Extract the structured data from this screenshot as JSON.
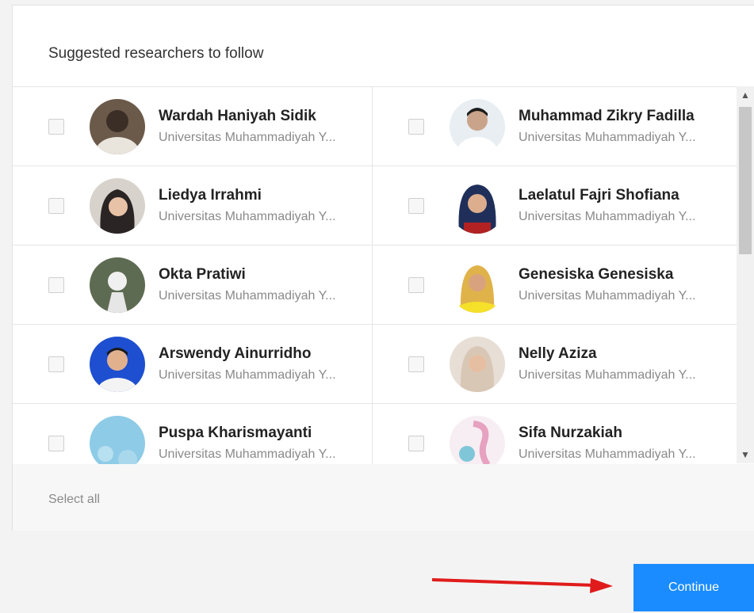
{
  "dialog": {
    "title": "Suggested researchers to follow",
    "select_all_label": "Select all",
    "continue_label": "Continue"
  },
  "researchers": [
    {
      "name": "Wardah Haniyah Sidik",
      "affiliation": "Universitas Muhammadiyah Y...",
      "checked": false,
      "avatar_color": "#6b5a4a"
    },
    {
      "name": "Muhammad Zikry Fadilla",
      "affiliation": "Universitas Muhammadiyah Y...",
      "checked": false,
      "avatar_color": "#e8eef2"
    },
    {
      "name": "Liedya Irrahmi",
      "affiliation": "Universitas Muhammadiyah Y...",
      "checked": false,
      "avatar_color": "#3a3434"
    },
    {
      "name": "Laelatul Fajri Shofiana",
      "affiliation": "Universitas Muhammadiyah Y...",
      "checked": false,
      "avatar_color": "#1f2f5a"
    },
    {
      "name": "Okta Pratiwi",
      "affiliation": "Universitas Muhammadiyah Y...",
      "checked": false,
      "avatar_color": "#5d6b52"
    },
    {
      "name": "Genesiska Genesiska",
      "affiliation": "Universitas Muhammadiyah Y...",
      "checked": false,
      "avatar_color": "#f2d24a"
    },
    {
      "name": "Arswendy Ainurridho",
      "affiliation": "Universitas Muhammadiyah Y...",
      "checked": false,
      "avatar_color": "#1e4fd0"
    },
    {
      "name": "Nelly Aziza",
      "affiliation": "Universitas Muhammadiyah Y...",
      "checked": false,
      "avatar_color": "#d9c7b6"
    },
    {
      "name": "Puspa Kharismayanti",
      "affiliation": "Universitas Muhammadiyah Y...",
      "checked": false,
      "avatar_color": "#8ecbe6"
    },
    {
      "name": "Sifa Nurzakiah",
      "affiliation": "Universitas Muhammadiyah Y...",
      "checked": false,
      "avatar_color": "#e6a2c0"
    }
  ],
  "colors": {
    "primary_button": "#1a8cff",
    "annotation_arrow": "#e01b1b"
  },
  "icons": {
    "scroll_up": "chevron-up-icon",
    "scroll_down": "chevron-down-icon",
    "arrow": "red-arrow-icon"
  }
}
